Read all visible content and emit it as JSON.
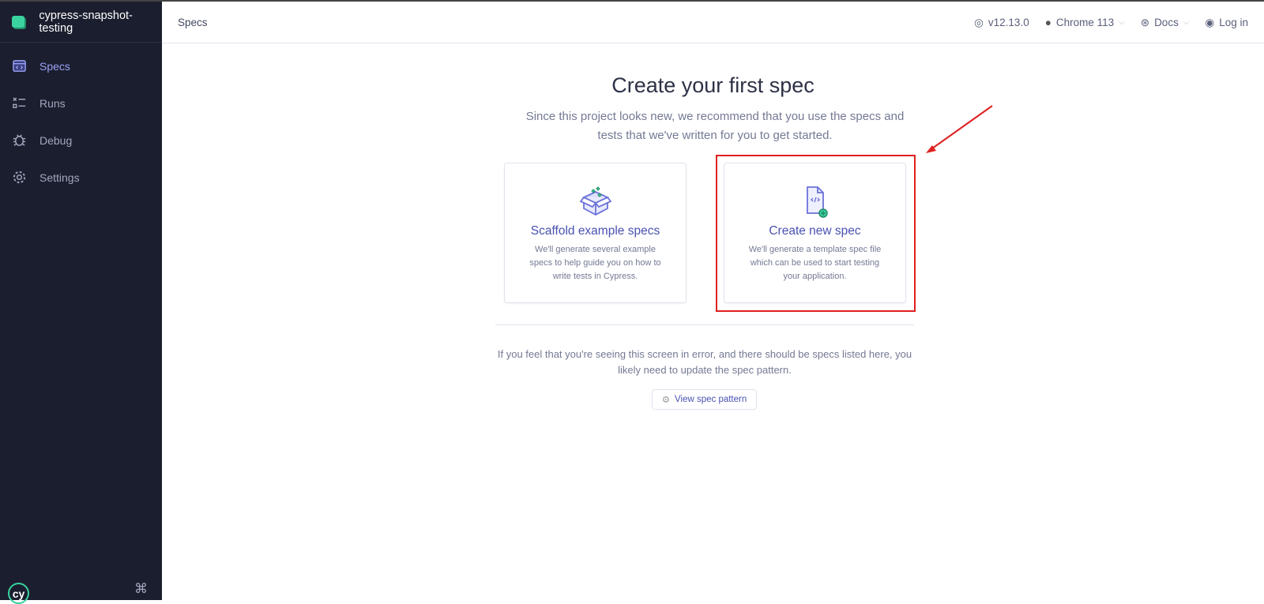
{
  "project_name": "cypress-snapshot-testing",
  "sidebar": {
    "items": [
      {
        "label": "Specs",
        "icon": "specs-icon"
      },
      {
        "label": "Runs",
        "icon": "runs-icon"
      },
      {
        "label": "Debug",
        "icon": "bug-icon"
      },
      {
        "label": "Settings",
        "icon": "gear-icon"
      }
    ],
    "logo_text": "cy",
    "shortcut": "⌘"
  },
  "header": {
    "breadcrumb": "Specs",
    "version": "v12.13.0",
    "browser": "Chrome 113",
    "docs": "Docs",
    "login": "Log in"
  },
  "main": {
    "title": "Create your first spec",
    "subtitle": "Since this project looks new, we recommend that you use the specs and tests that we've written for you to get started.",
    "cards": [
      {
        "title": "Scaffold example specs",
        "description": "We'll generate several example specs to help guide you on how to write tests in Cypress."
      },
      {
        "title": "Create new spec",
        "description": "We'll generate a template spec file which can be used to start testing your application."
      }
    ],
    "error_text": "If you feel that you're seeing this screen in error, and there should be specs listed here, you likely need to update the spec pattern.",
    "view_spec_pattern": "View spec pattern"
  },
  "colors": {
    "sidebar": "#1b1e2e",
    "accent": "#4951b2",
    "highlight": "#e02020",
    "green": "#3ad29f"
  }
}
